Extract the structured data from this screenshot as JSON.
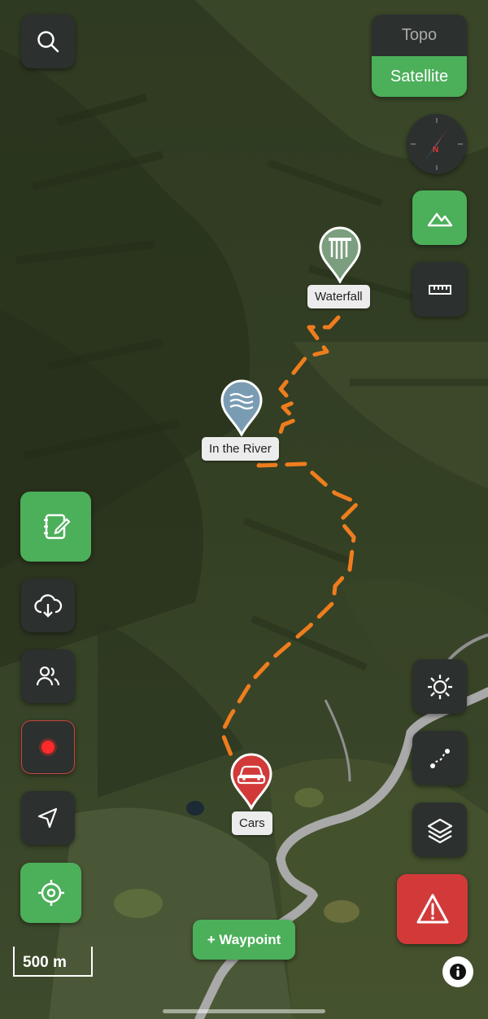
{
  "map_mode": {
    "topo_label": "Topo",
    "satellite_label": "Satellite",
    "selected": "Satellite"
  },
  "markers": [
    {
      "label": "Waterfall",
      "icon": "waterfall-icon",
      "color": "#7a9e7e"
    },
    {
      "label": "In the River",
      "icon": "water-waves-icon",
      "color": "#7a9cb3"
    },
    {
      "label": "Cars",
      "icon": "car-icon",
      "color": "#d23a3a"
    }
  ],
  "waypoint_button": {
    "label": "+ Waypoint"
  },
  "scale": {
    "label": "500 m"
  },
  "colors": {
    "accent_green": "#4caf5a",
    "sos_red": "#d23a3a",
    "button_dark": "#2c302e",
    "route_orange": "#ef7d1e"
  },
  "left_toolbar": [
    "notebook-icon",
    "cloud-download-icon",
    "people-icon",
    "record-icon",
    "navigation-arrow-icon",
    "target-icon"
  ],
  "right_toolbar": [
    "compass-icon",
    "terrain-icon",
    "ruler-icon",
    "brightness-icon",
    "route-icon",
    "layers-icon",
    "alert-triangle-icon"
  ]
}
